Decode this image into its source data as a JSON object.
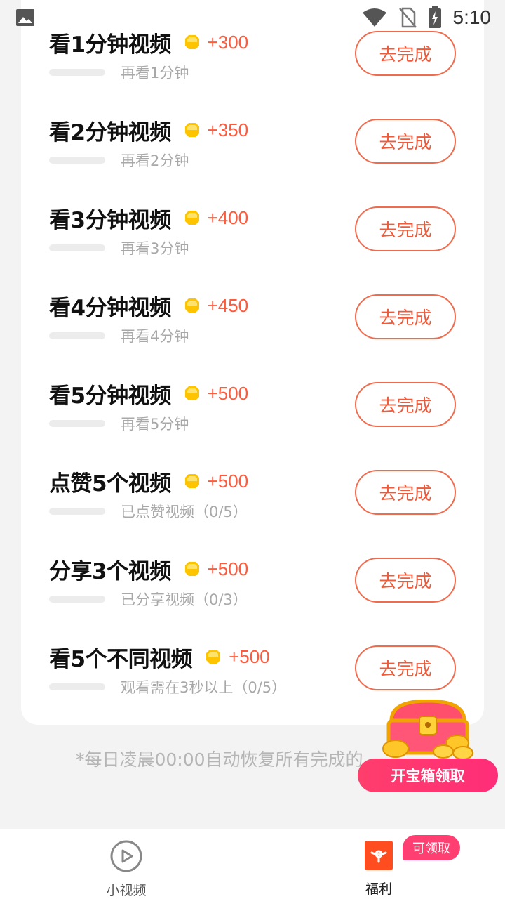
{
  "status_bar": {
    "time": "5:10",
    "icons": [
      "image-icon",
      "wifi-icon",
      "no-sim-icon",
      "battery-charging-icon"
    ]
  },
  "tasks": [
    {
      "title": "看1分钟视频",
      "reward": "+300",
      "subtitle": "再看1分钟",
      "button": "去完成",
      "progress": 0
    },
    {
      "title": "看2分钟视频",
      "reward": "+350",
      "subtitle": "再看2分钟",
      "button": "去完成",
      "progress": 0
    },
    {
      "title": "看3分钟视频",
      "reward": "+400",
      "subtitle": "再看3分钟",
      "button": "去完成",
      "progress": 0
    },
    {
      "title": "看4分钟视频",
      "reward": "+450",
      "subtitle": "再看4分钟",
      "button": "去完成",
      "progress": 0
    },
    {
      "title": "看5分钟视频",
      "reward": "+500",
      "subtitle": "再看5分钟",
      "button": "去完成",
      "progress": 0
    },
    {
      "title": "点赞5个视频",
      "reward": "+500",
      "subtitle": "已点赞视频（0/5）",
      "button": "去完成",
      "progress": 0
    },
    {
      "title": "分享3个视频",
      "reward": "+500",
      "subtitle": "已分享视频（0/3）",
      "button": "去完成",
      "progress": 0
    },
    {
      "title": "看5个不同视频",
      "reward": "+500",
      "subtitle": "观看需在3秒以上（0/5）",
      "button": "去完成",
      "progress": 0
    }
  ],
  "footnote": "*每日凌晨00:00自动恢复所有完成的",
  "treasure": {
    "button": "开宝箱领取"
  },
  "bottom_nav": {
    "items": [
      {
        "label": "小视频",
        "icon": "play-circle-icon"
      },
      {
        "label": "福利",
        "icon": "gift-icon"
      }
    ],
    "badge": "可领取"
  },
  "colors": {
    "accent": "#ff5a3c",
    "button_border": "#ef6b4e",
    "badge": "#ff3f71",
    "coin": "#ffcc00"
  }
}
